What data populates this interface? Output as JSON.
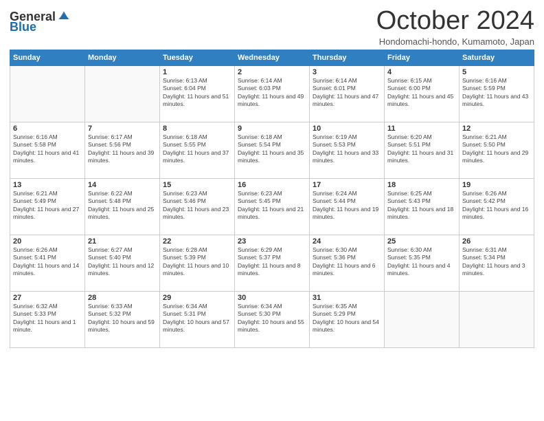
{
  "header": {
    "logo_general": "General",
    "logo_blue": "Blue",
    "month_title": "October 2024",
    "location": "Hondomachi-hondo, Kumamoto, Japan"
  },
  "weekdays": [
    "Sunday",
    "Monday",
    "Tuesday",
    "Wednesday",
    "Thursday",
    "Friday",
    "Saturday"
  ],
  "weeks": [
    [
      {
        "day": "",
        "sunrise": "",
        "sunset": "",
        "daylight": ""
      },
      {
        "day": "",
        "sunrise": "",
        "sunset": "",
        "daylight": ""
      },
      {
        "day": "1",
        "sunrise": "Sunrise: 6:13 AM",
        "sunset": "Sunset: 6:04 PM",
        "daylight": "Daylight: 11 hours and 51 minutes."
      },
      {
        "day": "2",
        "sunrise": "Sunrise: 6:14 AM",
        "sunset": "Sunset: 6:03 PM",
        "daylight": "Daylight: 11 hours and 49 minutes."
      },
      {
        "day": "3",
        "sunrise": "Sunrise: 6:14 AM",
        "sunset": "Sunset: 6:01 PM",
        "daylight": "Daylight: 11 hours and 47 minutes."
      },
      {
        "day": "4",
        "sunrise": "Sunrise: 6:15 AM",
        "sunset": "Sunset: 6:00 PM",
        "daylight": "Daylight: 11 hours and 45 minutes."
      },
      {
        "day": "5",
        "sunrise": "Sunrise: 6:16 AM",
        "sunset": "Sunset: 5:59 PM",
        "daylight": "Daylight: 11 hours and 43 minutes."
      }
    ],
    [
      {
        "day": "6",
        "sunrise": "Sunrise: 6:16 AM",
        "sunset": "Sunset: 5:58 PM",
        "daylight": "Daylight: 11 hours and 41 minutes."
      },
      {
        "day": "7",
        "sunrise": "Sunrise: 6:17 AM",
        "sunset": "Sunset: 5:56 PM",
        "daylight": "Daylight: 11 hours and 39 minutes."
      },
      {
        "day": "8",
        "sunrise": "Sunrise: 6:18 AM",
        "sunset": "Sunset: 5:55 PM",
        "daylight": "Daylight: 11 hours and 37 minutes."
      },
      {
        "day": "9",
        "sunrise": "Sunrise: 6:18 AM",
        "sunset": "Sunset: 5:54 PM",
        "daylight": "Daylight: 11 hours and 35 minutes."
      },
      {
        "day": "10",
        "sunrise": "Sunrise: 6:19 AM",
        "sunset": "Sunset: 5:53 PM",
        "daylight": "Daylight: 11 hours and 33 minutes."
      },
      {
        "day": "11",
        "sunrise": "Sunrise: 6:20 AM",
        "sunset": "Sunset: 5:51 PM",
        "daylight": "Daylight: 11 hours and 31 minutes."
      },
      {
        "day": "12",
        "sunrise": "Sunrise: 6:21 AM",
        "sunset": "Sunset: 5:50 PM",
        "daylight": "Daylight: 11 hours and 29 minutes."
      }
    ],
    [
      {
        "day": "13",
        "sunrise": "Sunrise: 6:21 AM",
        "sunset": "Sunset: 5:49 PM",
        "daylight": "Daylight: 11 hours and 27 minutes."
      },
      {
        "day": "14",
        "sunrise": "Sunrise: 6:22 AM",
        "sunset": "Sunset: 5:48 PM",
        "daylight": "Daylight: 11 hours and 25 minutes."
      },
      {
        "day": "15",
        "sunrise": "Sunrise: 6:23 AM",
        "sunset": "Sunset: 5:46 PM",
        "daylight": "Daylight: 11 hours and 23 minutes."
      },
      {
        "day": "16",
        "sunrise": "Sunrise: 6:23 AM",
        "sunset": "Sunset: 5:45 PM",
        "daylight": "Daylight: 11 hours and 21 minutes."
      },
      {
        "day": "17",
        "sunrise": "Sunrise: 6:24 AM",
        "sunset": "Sunset: 5:44 PM",
        "daylight": "Daylight: 11 hours and 19 minutes."
      },
      {
        "day": "18",
        "sunrise": "Sunrise: 6:25 AM",
        "sunset": "Sunset: 5:43 PM",
        "daylight": "Daylight: 11 hours and 18 minutes."
      },
      {
        "day": "19",
        "sunrise": "Sunrise: 6:26 AM",
        "sunset": "Sunset: 5:42 PM",
        "daylight": "Daylight: 11 hours and 16 minutes."
      }
    ],
    [
      {
        "day": "20",
        "sunrise": "Sunrise: 6:26 AM",
        "sunset": "Sunset: 5:41 PM",
        "daylight": "Daylight: 11 hours and 14 minutes."
      },
      {
        "day": "21",
        "sunrise": "Sunrise: 6:27 AM",
        "sunset": "Sunset: 5:40 PM",
        "daylight": "Daylight: 11 hours and 12 minutes."
      },
      {
        "day": "22",
        "sunrise": "Sunrise: 6:28 AM",
        "sunset": "Sunset: 5:39 PM",
        "daylight": "Daylight: 11 hours and 10 minutes."
      },
      {
        "day": "23",
        "sunrise": "Sunrise: 6:29 AM",
        "sunset": "Sunset: 5:37 PM",
        "daylight": "Daylight: 11 hours and 8 minutes."
      },
      {
        "day": "24",
        "sunrise": "Sunrise: 6:30 AM",
        "sunset": "Sunset: 5:36 PM",
        "daylight": "Daylight: 11 hours and 6 minutes."
      },
      {
        "day": "25",
        "sunrise": "Sunrise: 6:30 AM",
        "sunset": "Sunset: 5:35 PM",
        "daylight": "Daylight: 11 hours and 4 minutes."
      },
      {
        "day": "26",
        "sunrise": "Sunrise: 6:31 AM",
        "sunset": "Sunset: 5:34 PM",
        "daylight": "Daylight: 11 hours and 3 minutes."
      }
    ],
    [
      {
        "day": "27",
        "sunrise": "Sunrise: 6:32 AM",
        "sunset": "Sunset: 5:33 PM",
        "daylight": "Daylight: 11 hours and 1 minute."
      },
      {
        "day": "28",
        "sunrise": "Sunrise: 6:33 AM",
        "sunset": "Sunset: 5:32 PM",
        "daylight": "Daylight: 10 hours and 59 minutes."
      },
      {
        "day": "29",
        "sunrise": "Sunrise: 6:34 AM",
        "sunset": "Sunset: 5:31 PM",
        "daylight": "Daylight: 10 hours and 57 minutes."
      },
      {
        "day": "30",
        "sunrise": "Sunrise: 6:34 AM",
        "sunset": "Sunset: 5:30 PM",
        "daylight": "Daylight: 10 hours and 55 minutes."
      },
      {
        "day": "31",
        "sunrise": "Sunrise: 6:35 AM",
        "sunset": "Sunset: 5:29 PM",
        "daylight": "Daylight: 10 hours and 54 minutes."
      },
      {
        "day": "",
        "sunrise": "",
        "sunset": "",
        "daylight": ""
      },
      {
        "day": "",
        "sunrise": "",
        "sunset": "",
        "daylight": ""
      }
    ]
  ]
}
